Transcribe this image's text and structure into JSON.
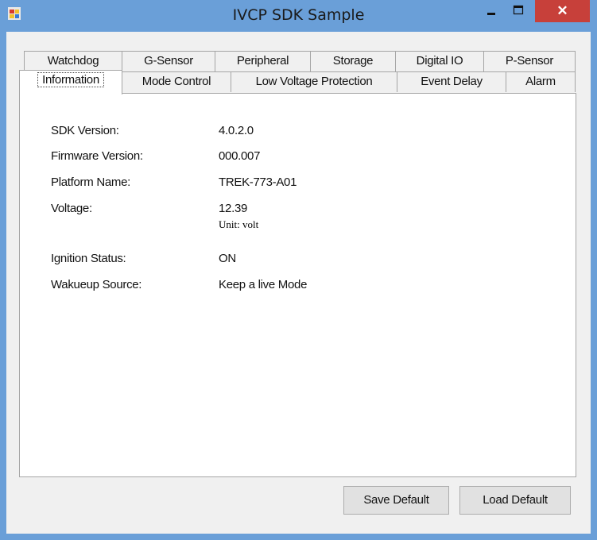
{
  "window": {
    "title": "IVCP SDK Sample",
    "close_glyph": "✕"
  },
  "tabs": {
    "back_row": [
      {
        "label": "Watchdog"
      },
      {
        "label": "G-Sensor"
      },
      {
        "label": "Peripheral"
      },
      {
        "label": "Storage"
      },
      {
        "label": "Digital IO"
      },
      {
        "label": "P-Sensor"
      }
    ],
    "front_row": [
      {
        "label": "Information",
        "active": true
      },
      {
        "label": "Mode Control"
      },
      {
        "label": "Low Voltage Protection"
      },
      {
        "label": "Event Delay"
      },
      {
        "label": "Alarm"
      }
    ]
  },
  "info": {
    "sdk_version": {
      "label": "SDK Version:",
      "value": "4.0.2.0"
    },
    "firmware_version": {
      "label": "Firmware Version:",
      "value": "000.007"
    },
    "platform_name": {
      "label": "Platform Name:",
      "value": "TREK-773-A01"
    },
    "voltage": {
      "label": "Voltage:",
      "value": "12.39",
      "unit": "Unit: volt"
    },
    "ignition_status": {
      "label": "Ignition Status:",
      "value": "ON"
    },
    "wakeup_source": {
      "label": "Wakueup Source:",
      "value": "Keep a live Mode"
    }
  },
  "buttons": {
    "save_default": "Save Default",
    "load_default": "Load Default"
  },
  "colors": {
    "titlebar": "#6a9fd8",
    "close": "#c7403a",
    "form_bg": "#f0f0f0"
  }
}
